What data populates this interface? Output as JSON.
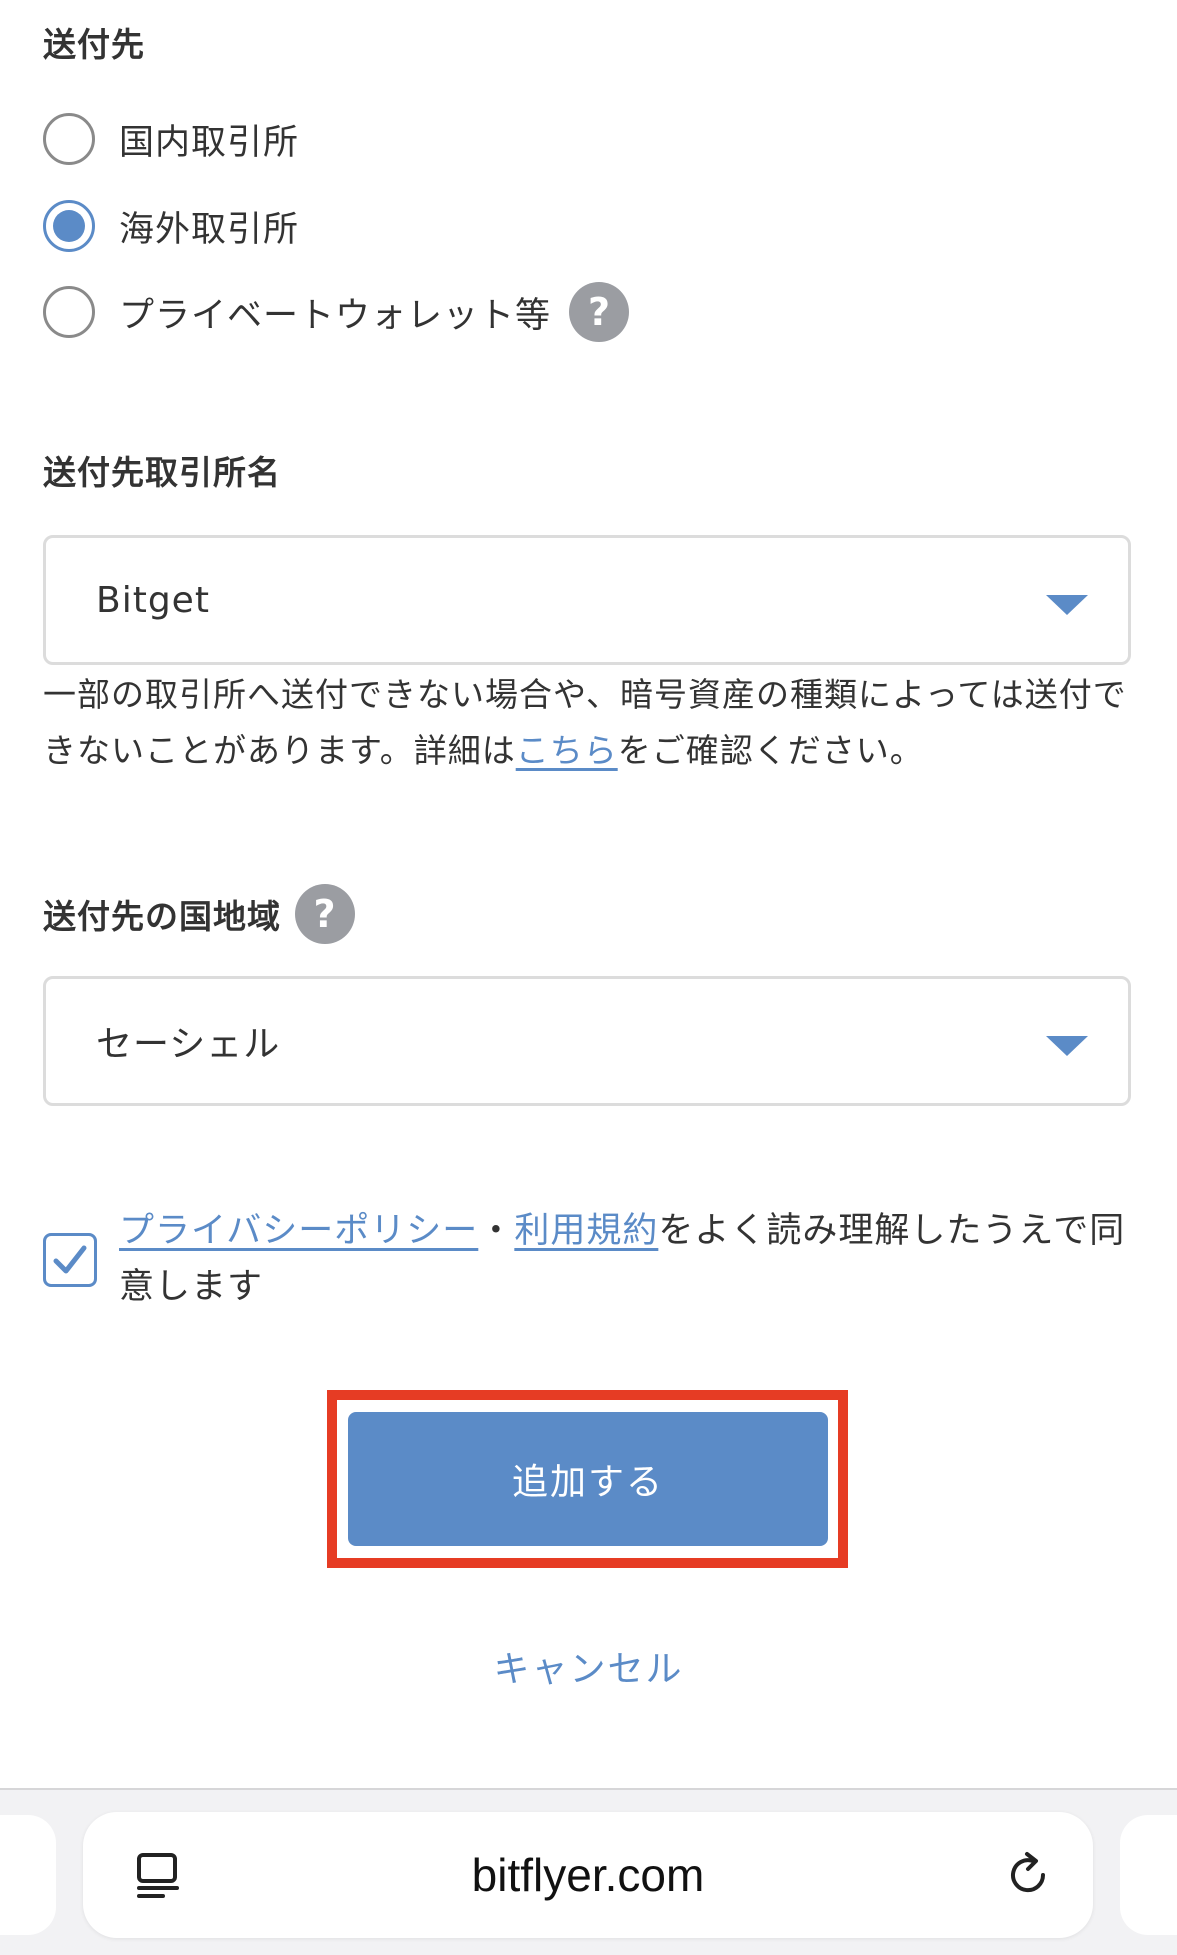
{
  "destination": {
    "title": "送付先",
    "options": [
      {
        "label": "国内取引所",
        "selected": false
      },
      {
        "label": "海外取引所",
        "selected": true
      },
      {
        "label": "プライベートウォレット等",
        "selected": false,
        "has_help": true
      }
    ],
    "help_glyph": "?"
  },
  "exchange": {
    "title": "送付先取引所名",
    "selected_value": "Bitget",
    "note_before_link": "一部の取引所へ送付できない場合や、暗号資産の種類によっては送付できないことがあります。詳細は",
    "note_link": "こちら",
    "note_after_link": "をご確認ください。"
  },
  "region": {
    "title": "送付先の国地域",
    "help_glyph": "?",
    "selected_value": "セーシェル"
  },
  "agreement": {
    "checked": true,
    "privacy_link": "プライバシーポリシー",
    "separator": "・",
    "terms_link": "利用規約",
    "suffix": "をよく読み理解したうえで同意します"
  },
  "actions": {
    "submit_label": "追加する",
    "cancel_label": "キャンセル"
  },
  "browser": {
    "url": "bitflyer.com"
  },
  "colors": {
    "accent": "#5b8bc7",
    "highlight": "#e63c24",
    "help_icon": "#9b9da2"
  }
}
